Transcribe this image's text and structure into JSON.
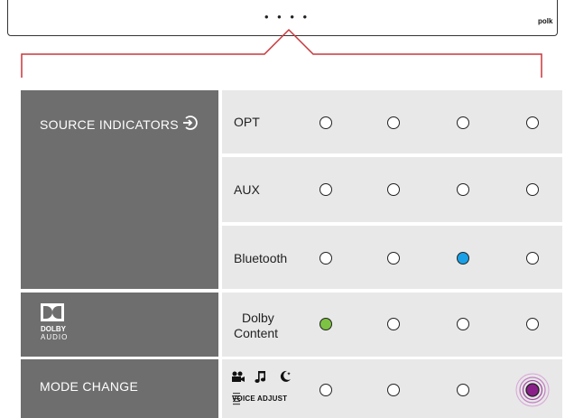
{
  "soundbar": {
    "led_dots": "• • • •",
    "brand": "polk"
  },
  "left_panels": {
    "source_indicators": "SOURCE INDICATORS",
    "dolby_logo_line1": "DOLBY",
    "dolby_logo_line2": "AUDIO",
    "mode_change": "MODE CHANGE"
  },
  "rows": [
    {
      "label": "OPT",
      "indicators": [
        "off",
        "off",
        "off",
        "off"
      ]
    },
    {
      "label": "AUX",
      "indicators": [
        "off",
        "off",
        "off",
        "off"
      ]
    },
    {
      "label": "Bluetooth",
      "indicators": [
        "off",
        "off",
        "on",
        "off"
      ]
    },
    {
      "label_line1": "Dolby",
      "label_line2": "Content",
      "indicators": [
        "on",
        "off",
        "off",
        "off"
      ]
    },
    {
      "voice_adjust": "VOICE ADJUST",
      "indicators": [
        "off",
        "off",
        "off",
        "on"
      ]
    }
  ],
  "colors": {
    "panel_dark": "#6e6e6e",
    "panel_light": "#e8e8e8",
    "bracket": "#c8373c",
    "bluetooth_led": "#1aa0e6",
    "dolby_led": "#7dc242",
    "mode_led": "#8a1f8a"
  },
  "icons": [
    "source-input-icon",
    "dolby-logo-icon",
    "movie-camera-icon",
    "music-note-icon",
    "moon-icon"
  ]
}
